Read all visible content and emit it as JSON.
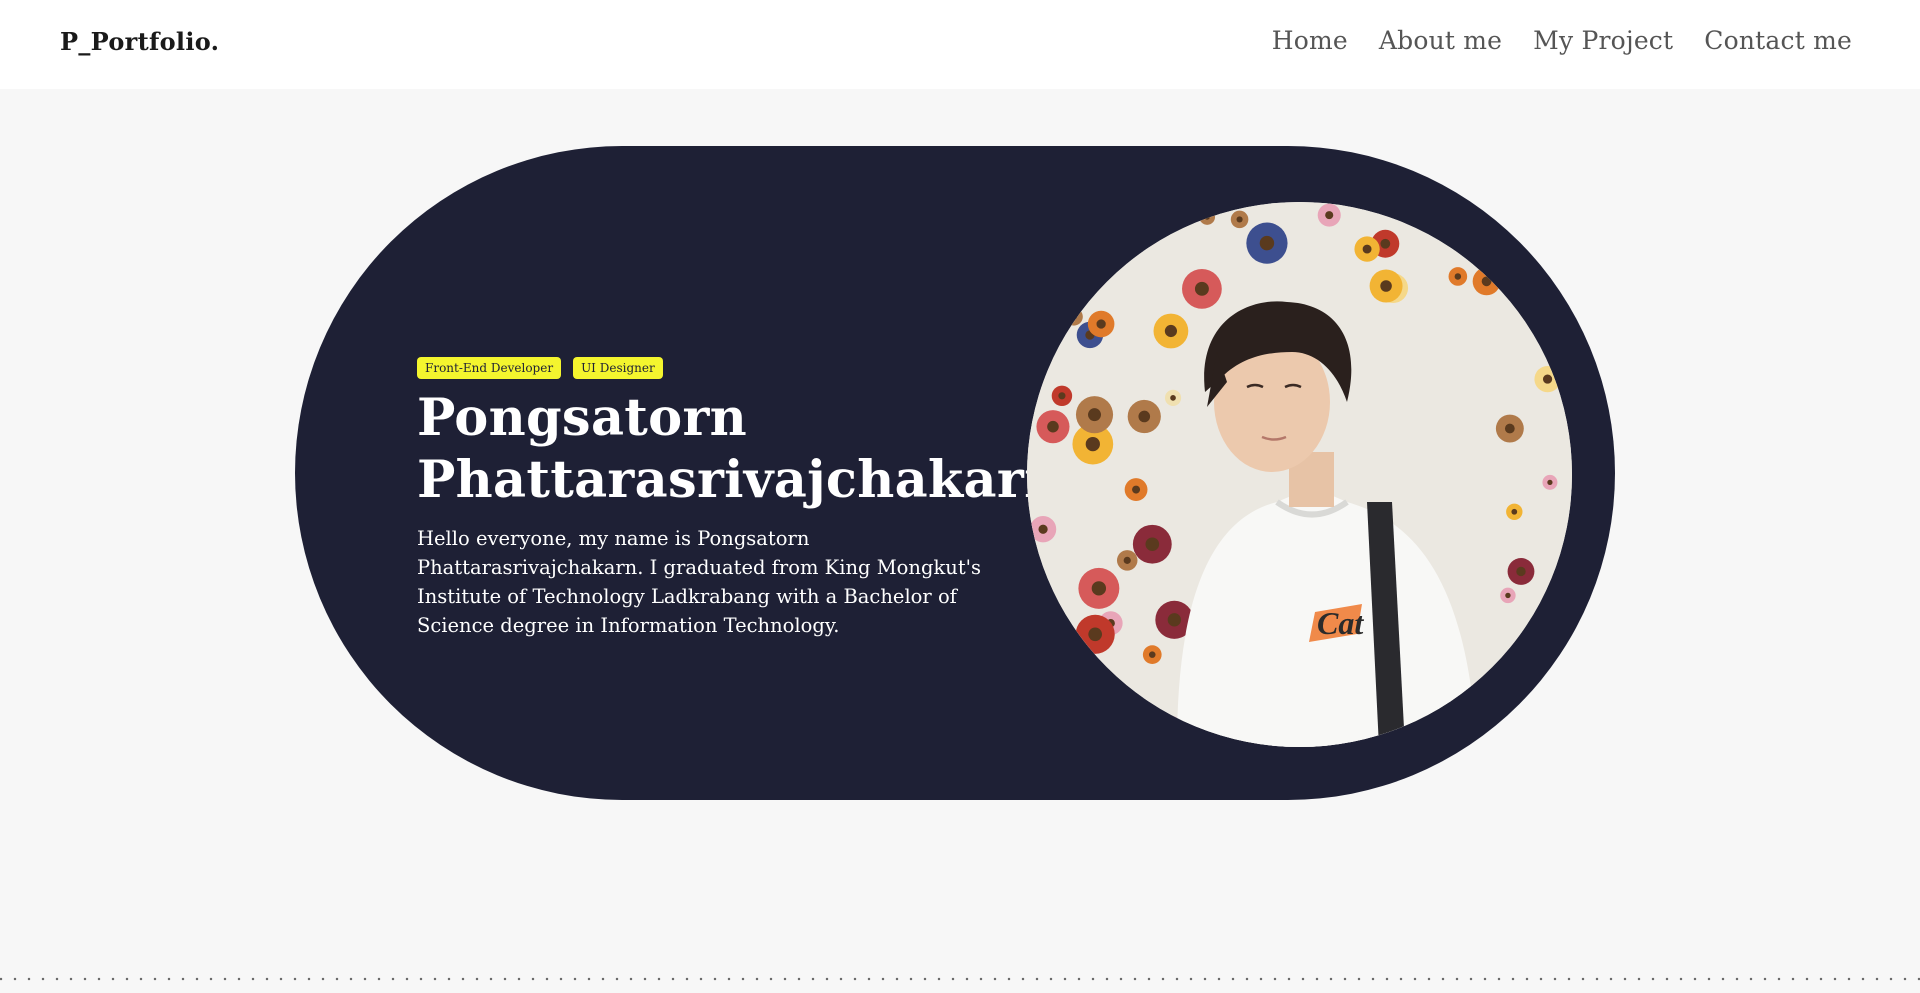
{
  "header": {
    "logo": "P_Portfolio.",
    "nav": [
      {
        "label": "Home"
      },
      {
        "label": "About me"
      },
      {
        "label": "My Project"
      },
      {
        "label": "Contact me"
      }
    ]
  },
  "hero": {
    "tags": [
      "Front-End Developer",
      "UI Designer"
    ],
    "name_line1": "Pongsatorn",
    "name_line2": "Phattarasrivajchakarn",
    "intro": "Hello everyone, my name is Pongsatorn Phattarasrivajchakarn. I graduated from King Mongkut's Institute of Technology Ladkrabang with a Bachelor of Science degree in Information Technology.",
    "photo": {
      "icon": "profile-photo",
      "shirt_text": "Cat"
    }
  },
  "colors": {
    "hero_bg": "#1e2035",
    "tag_bg": "#f4f52e",
    "page_bg": "#f7f7f7",
    "header_bg": "#ffffff"
  }
}
